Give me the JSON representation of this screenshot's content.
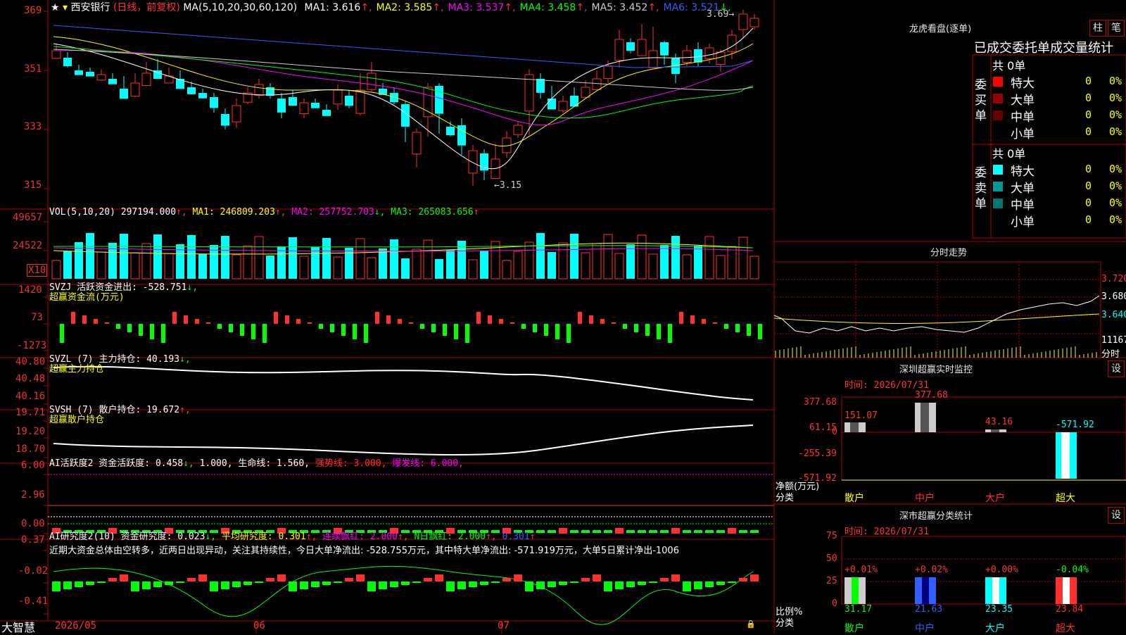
{
  "main": {
    "stock_name": "西安银行",
    "period": "(日线，前复权)",
    "ma_header": "MA(5,10,20,30,60,120)",
    "ma_values": [
      {
        "label": "MA1: 3.616",
        "arrow": "↑",
        "color": "#ffffff"
      },
      {
        "label": "MA2: 3.585",
        "arrow": "↑",
        "color": "#ffff00"
      },
      {
        "label": "MA3: 3.537",
        "arrow": "↑",
        "color": "#ff00ff"
      },
      {
        "label": "MA4: 3.458",
        "arrow": "↑",
        "color": "#00ff00"
      },
      {
        "label": "MA5: 3.452",
        "arrow": "↑",
        "color": "#cccccc"
      },
      {
        "label": "MA6: 3.521",
        "arrow": "↓",
        "color": "#3060ff"
      }
    ],
    "high_marker": "3.69",
    "low_marker": "←3.15",
    "y_ticks": [
      "369",
      "351",
      "333",
      "315"
    ]
  },
  "vol": {
    "header": "VOL(5,10,20)",
    "value": "297194.000",
    "ma1": "MA1: 246809.203",
    "ma2": "MA2: 257752.703",
    "ma3": "MA3: 265083.656",
    "y_ticks": [
      "49657",
      "24522"
    ],
    "unit": "X10"
  },
  "svzj": {
    "header": "SVZJ  活跃资金进出: -528.751",
    "sub": "超赢资金流(万元)",
    "y_ticks": [
      "1420",
      "73",
      "-1273"
    ]
  },
  "svzl": {
    "header": "SVZL (7) 主力持仓: 40.193",
    "sub": "超赢主力持仓",
    "y_ticks": [
      "40.80",
      "40.48",
      "40.16"
    ]
  },
  "svsh": {
    "header": "SVSH (7) 散户持仓: 19.672",
    "sub": "超赢散户持仓",
    "y_ticks": [
      "19.71",
      "19.20",
      "18.70"
    ]
  },
  "ai_active": {
    "header": "AI活跃度2 资金活跃度: 0.458",
    "v2": "1.000,",
    "v3": "生命线: 1.560,",
    "v4": "强势线: 3.000,",
    "v5": "爆发线: 6.000,",
    "y_ticks": [
      "6.00",
      "2.96",
      "0.00"
    ]
  },
  "ai_research": {
    "header": "AI研究度2(10) 资金研究度: 0.023",
    "v2": "平均研究度: 0.301",
    "v3": "连续飘红: 2.000",
    "v4": "N日飘红: 2.000",
    "v5": "0.301",
    "comment": "近期大资金总体由空转多，近两日出现异动，关注其持续性，今日大单净流出: -528.755万元，其中特大单净流出: -571.919万元，大单5日累计净出-1006",
    "y_ticks": [
      "0.37",
      "-0.02",
      "-0.41"
    ]
  },
  "footer": {
    "brand": "大智慧",
    "dates": [
      "2026/05",
      "06",
      "07"
    ]
  },
  "dragon": {
    "title": "龙虎看盘(逐单)",
    "btn1": "柱",
    "btn2": "笔",
    "subtitle": "已成交委托单成交量统计",
    "buy_label": "委买单",
    "sell_label": "委卖单",
    "buy_total": "共 0单",
    "sell_total": "共 0单",
    "buy_rows": [
      {
        "name": "特大",
        "count": "0",
        "pct": "0%",
        "color": "#ff0000"
      },
      {
        "name": "大单",
        "count": "0",
        "pct": "0%",
        "color": "#990000"
      },
      {
        "name": "中单",
        "count": "0",
        "pct": "0%",
        "color": "#660000"
      },
      {
        "name": "小单",
        "count": "0",
        "pct": "0%",
        "color": "#000000"
      }
    ],
    "sell_rows": [
      {
        "name": "特大",
        "count": "0",
        "pct": "0%",
        "color": "#00ffff"
      },
      {
        "name": "大单",
        "count": "0",
        "pct": "0%",
        "color": "#009999"
      },
      {
        "name": "中单",
        "count": "0",
        "pct": "0%",
        "color": "#007777"
      },
      {
        "name": "小单",
        "count": "0",
        "pct": "0%",
        "color": "#000000"
      }
    ]
  },
  "intraday": {
    "title": "分时走势",
    "prices": [
      "3.720",
      "3.680",
      "3.640"
    ],
    "vol": "11167",
    "vol_label": "分时"
  },
  "sz_monitor": {
    "title": "深圳超赢实时监控",
    "btn": "设",
    "date": "时间: 2026/07/31",
    "y_ticks": [
      "377.68",
      "61.15",
      "0",
      "-255.39",
      "-571.92"
    ],
    "ylabel": "净额(万元)",
    "xlabel": "分类",
    "bars": [
      {
        "name": "散户",
        "value": "151.07"
      },
      {
        "name": "中户",
        "value": "377.68"
      },
      {
        "name": "大户",
        "value": "43.16"
      },
      {
        "name": "超大",
        "value": "-571.92"
      }
    ]
  },
  "sz_stats": {
    "title": "深市超赢分类统计",
    "btn": "设",
    "date": "时间: 2026/07/31",
    "y_ticks": [
      "75",
      "50",
      "25",
      "0"
    ],
    "ylabel": "比例%",
    "xlabel": "分类",
    "bars": [
      {
        "name": "散户",
        "change": "+0.01%",
        "value": "31.17"
      },
      {
        "name": "中户",
        "change": "+0.02%",
        "value": "21.63"
      },
      {
        "name": "大户",
        "change": "+0.00%",
        "value": "23.35"
      },
      {
        "name": "超大",
        "change": "-0.04%",
        "value": "23.84"
      }
    ]
  }
}
